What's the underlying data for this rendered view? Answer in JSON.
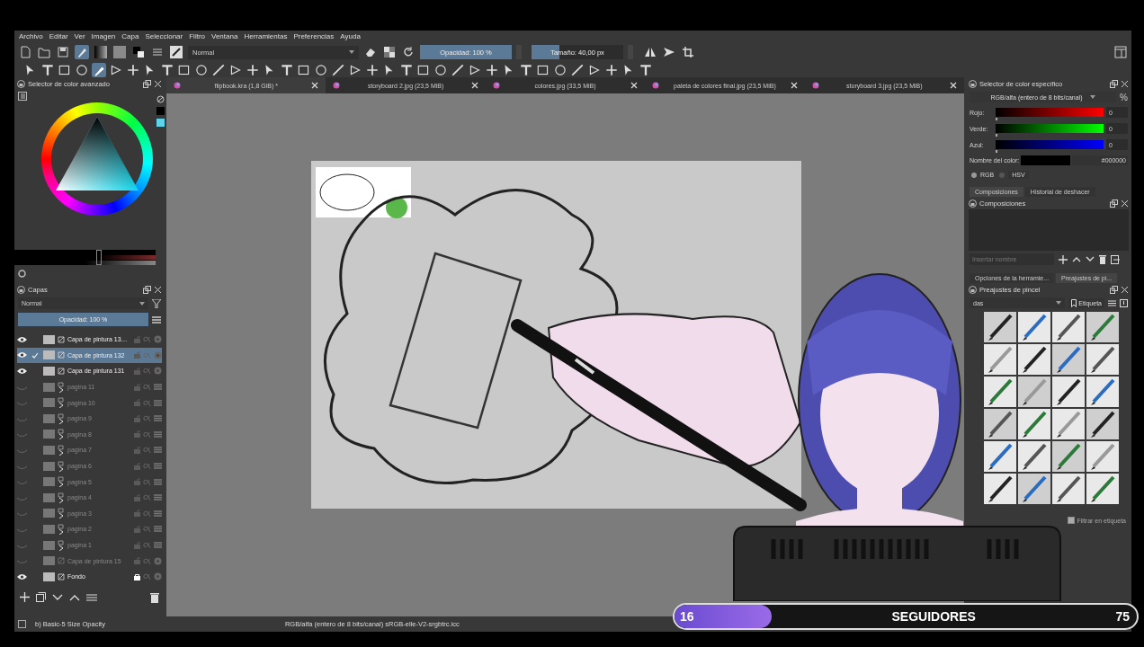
{
  "menu": [
    "Archivo",
    "Editar",
    "Ver",
    "Imagen",
    "Capa",
    "Seleccionar",
    "Filtro",
    "Ventana",
    "Herramientas",
    "Preferencias",
    "Ayuda"
  ],
  "tool_options": {
    "blend_mode": "Normal",
    "opacity": {
      "label": "Opacidad: 100 %",
      "level": 1
    },
    "size": {
      "label": "Tamaño: 40,00 px",
      "level": 0.3
    }
  },
  "toolbox": [
    {
      "selected": false
    },
    {
      "selected": false
    },
    {
      "selected": false
    },
    {
      "selected": false
    },
    {
      "selected": true
    },
    {
      "selected": false
    },
    {
      "selected": false
    },
    {
      "selected": false
    },
    {
      "selected": false
    },
    {
      "selected": false
    },
    {
      "selected": false
    },
    {
      "selected": false
    },
    {
      "selected": false
    },
    {
      "selected": false
    },
    {
      "selected": false
    },
    {
      "selected": false
    },
    {
      "selected": false
    },
    {
      "selected": false
    },
    {
      "selected": false
    },
    {
      "selected": false
    },
    {
      "selected": false
    },
    {
      "selected": false
    },
    {
      "selected": false
    },
    {
      "selected": false
    },
    {
      "selected": false
    },
    {
      "selected": false
    },
    {
      "selected": false
    },
    {
      "selected": false
    },
    {
      "selected": false
    },
    {
      "selected": false
    },
    {
      "selected": false
    },
    {
      "selected": false
    },
    {
      "selected": false
    },
    {
      "selected": false
    },
    {
      "selected": false
    },
    {
      "selected": false
    },
    {
      "selected": false
    }
  ],
  "color_selector": {
    "title": "Selector de color avanzado",
    "shade_slider": {
      "level": 0.6
    }
  },
  "layers": {
    "title": "Capas",
    "blend_mode": "Normal",
    "opacity": {
      "label": "Opacidad:  100 %",
      "level": 1
    },
    "items": [
      {
        "name": "Capa de pintura 13…",
        "kind": "paint",
        "visible": true,
        "selected": false,
        "locked": false
      },
      {
        "name": "Capa de pintura 132",
        "kind": "paint",
        "visible": true,
        "selected": true,
        "locked": false
      },
      {
        "name": "Capa de pintura 131",
        "kind": "paint",
        "visible": true,
        "selected": false,
        "locked": false
      },
      {
        "name": "pagina 11",
        "kind": "group",
        "visible": false,
        "selected": false,
        "locked": false
      },
      {
        "name": "pagina 10",
        "kind": "group",
        "visible": false,
        "selected": false,
        "locked": false
      },
      {
        "name": "pagina 9",
        "kind": "group",
        "visible": false,
        "selected": false,
        "locked": false
      },
      {
        "name": "pagina 8",
        "kind": "group",
        "visible": false,
        "selected": false,
        "locked": false
      },
      {
        "name": "pagina 7",
        "kind": "group",
        "visible": false,
        "selected": false,
        "locked": false
      },
      {
        "name": "pagina 6",
        "kind": "group",
        "visible": false,
        "selected": false,
        "locked": false
      },
      {
        "name": "pagina 5",
        "kind": "group",
        "visible": false,
        "selected": false,
        "locked": false
      },
      {
        "name": "pagina 4",
        "kind": "group",
        "visible": false,
        "selected": false,
        "locked": false
      },
      {
        "name": "pagina 3",
        "kind": "group",
        "visible": false,
        "selected": false,
        "locked": false
      },
      {
        "name": "pagina 2",
        "kind": "group",
        "visible": false,
        "selected": false,
        "locked": false
      },
      {
        "name": "pagina 1",
        "kind": "group",
        "visible": false,
        "selected": false,
        "locked": false
      },
      {
        "name": "Capa de pintura 15",
        "kind": "paint",
        "visible": false,
        "selected": false,
        "locked": false
      },
      {
        "name": "Fondo",
        "kind": "paint",
        "visible": true,
        "selected": false,
        "locked": true
      }
    ]
  },
  "document_tabs": [
    {
      "title": "flipbook.kra (1,8 GiB) *",
      "selected": true
    },
    {
      "title": "storyboard 2.jpg (23,5 MiB)",
      "selected": false
    },
    {
      "title": "colores.jpg (33,5 MiB)",
      "selected": false
    },
    {
      "title": "paleta de colores final.jpg (23,5 MiB)",
      "selected": false
    },
    {
      "title": "storyboard 3.jpg (23,5 MiB)",
      "selected": false
    }
  ],
  "specific_color": {
    "title": "Selector de color específico",
    "model": "RGB/alfa (entero de 8 bits/canal)",
    "percent": "%",
    "channels": [
      {
        "label": "Rojo:",
        "value": "0",
        "kind": "red",
        "level": 0
      },
      {
        "label": "Verde:",
        "value": "0",
        "kind": "green",
        "level": 0
      },
      {
        "label": "Azul:",
        "value": "0",
        "kind": "blue",
        "level": 0
      }
    ],
    "name_label": "Nombre del color:",
    "hex": "#000000",
    "modes": [
      {
        "label": "RGB",
        "selected": true
      },
      {
        "label": "HSV",
        "selected": false
      }
    ]
  },
  "docker_tabs_top": [
    {
      "label": "Composiciones",
      "selected": true
    },
    {
      "label": "Historial de deshacer",
      "selected": false
    }
  ],
  "compositions": {
    "title": "Composiciones",
    "placeholder": "Insertar nombre"
  },
  "docker_tabs_bottom": [
    {
      "label": "Opciones de la herramie...",
      "selected": false
    },
    {
      "label": "Preajustes de pi...",
      "selected": true
    }
  ],
  "brush_presets": {
    "title": "Preajustes de pincel",
    "tag_filter": "das",
    "tag_button": "Etiqueta",
    "filter_label": "Filtrar en etiqueta",
    "filter_checked": true
  },
  "status_bar": {
    "brush": "b) Basic-5 Size Opacity",
    "color_space": "RGB/alfa (entero de 8 bits/canal)  sRGB-elle-V2-srgbtrc.icc"
  },
  "followers": {
    "count": "16",
    "label": "SEGUIDORES",
    "goal": "75",
    "level": 0.21
  }
}
